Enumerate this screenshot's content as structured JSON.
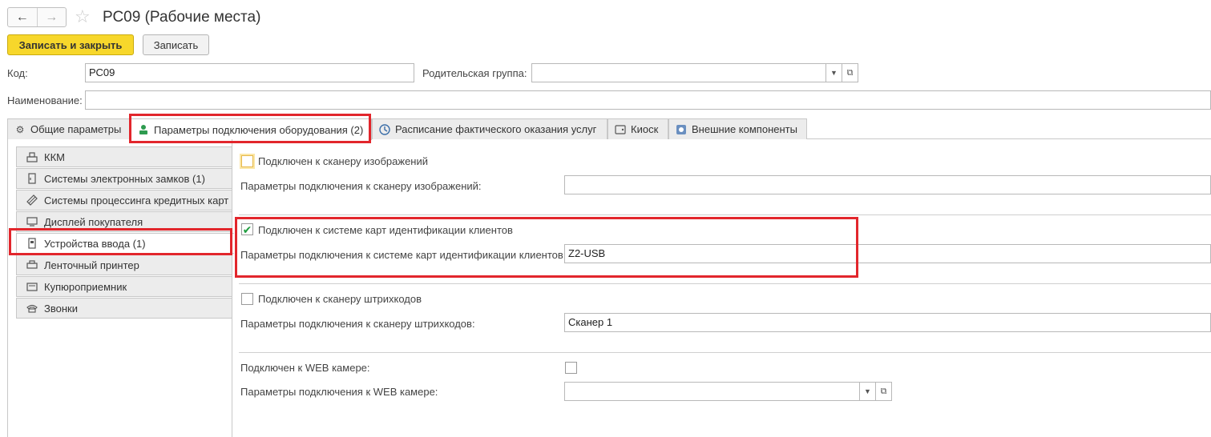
{
  "window": {
    "title": "РС09 (Рабочие места)",
    "back_icon": "←",
    "forward_icon": "→",
    "star_icon": "☆"
  },
  "toolbar": {
    "save_close_label": "Записать и закрыть",
    "save_label": "Записать"
  },
  "form": {
    "code_label": "Код:",
    "code_value": "РС09",
    "parent_label": "Родительская группа:",
    "parent_value": "",
    "name_label": "Наименование:",
    "name_value": ""
  },
  "tabs": [
    {
      "label": "Общие параметры",
      "icon": "gear-icon"
    },
    {
      "label": "Параметры подключения оборудования (2)",
      "icon": "person-equipment-icon"
    },
    {
      "label": "Расписание фактического оказания услуг",
      "icon": "clock-icon"
    },
    {
      "label": "Киоск",
      "icon": "kiosk-icon"
    },
    {
      "label": "Внешние компоненты",
      "icon": "components-icon"
    }
  ],
  "side_items": [
    {
      "label": "ККМ",
      "icon": "register-icon"
    },
    {
      "label": "Системы электронных замков (1)",
      "icon": "lock-icon"
    },
    {
      "label": "Системы процессинга кредитных карт",
      "icon": "card-icon"
    },
    {
      "label": "Дисплей покупателя",
      "icon": "monitor-icon"
    },
    {
      "label": "Устройства ввода (1)",
      "icon": "input-device-icon"
    },
    {
      "label": "Ленточный принтер",
      "icon": "printer-icon"
    },
    {
      "label": "Купюроприемник",
      "icon": "bill-acceptor-icon"
    },
    {
      "label": "Звонки",
      "icon": "phone-icon"
    }
  ],
  "content": {
    "image_scanner": {
      "checkbox_label": "Подключен к сканеру изображений",
      "checked": false,
      "params_label": "Параметры подключения к сканеру изображений:",
      "params_value": ""
    },
    "client_cards": {
      "checkbox_label": "Подключен к системе карт идентификации клиентов",
      "checked": true,
      "params_label": "Параметры подключения к системе карт идентификации клиентов:",
      "params_value": "Z2-USB"
    },
    "barcode_scanner": {
      "checkbox_label": "Подключен к сканеру штрихкодов",
      "checked": false,
      "params_label": "Параметры подключения к сканеру штрихкодов:",
      "params_value": "Сканер 1"
    },
    "web_camera": {
      "checkbox_label": "Подключен к WEB камере:",
      "checked": false,
      "params_label": "Параметры подключения к WEB камере:",
      "params_value": ""
    }
  },
  "colors": {
    "highlight": "#e2262c",
    "primary_button": "#f7d72b",
    "check": "#1f9d3f"
  }
}
